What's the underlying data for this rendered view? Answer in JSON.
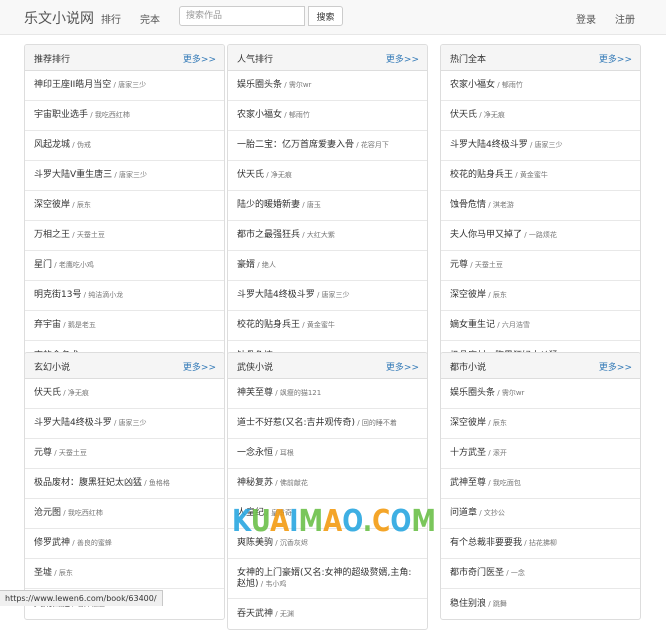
{
  "header": {
    "brand": "乐文小说网",
    "nav": [
      "排行",
      "完本"
    ],
    "search_placeholder": "搜索作品",
    "search_button": "搜索",
    "login": "登录",
    "register": "注册"
  },
  "panels": [
    {
      "title": "推荐排行",
      "more": "更多>>",
      "items": [
        {
          "title": "神印王座II皓月当空",
          "author": "唐家三少"
        },
        {
          "title": "宇宙职业选手",
          "author": "我吃西红柿"
        },
        {
          "title": "风起龙城",
          "author": "伪戒"
        },
        {
          "title": "斗罗大陆V重生唐三",
          "author": "唐家三少"
        },
        {
          "title": "深空彼岸",
          "author": "辰东"
        },
        {
          "title": "万相之王",
          "author": "天蚕土豆"
        },
        {
          "title": "星门",
          "author": "老鹰吃小鸡"
        },
        {
          "title": "明克街13号",
          "author": "纯洁滴小龙"
        },
        {
          "title": "弃宇宙",
          "author": "鹅是老五"
        },
        {
          "title": "夜的命名术",
          "author": "会说话的肘子"
        }
      ]
    },
    {
      "title": "人气排行",
      "more": "更多>>",
      "items": [
        {
          "title": "娱乐圈头条",
          "author": "需尔wr"
        },
        {
          "title": "农家小福女",
          "author": "郁雨竹"
        },
        {
          "title": "一胎二宝：亿万首席爱妻入骨",
          "author": "花容月下"
        },
        {
          "title": "伏天氏",
          "author": "净无痕"
        },
        {
          "title": "陆少的暖婚新妻",
          "author": "唐玉"
        },
        {
          "title": "都市之最强狂兵",
          "author": "大红大紫"
        },
        {
          "title": "豪婿",
          "author": "绝人"
        },
        {
          "title": "斗罗大陆4终极斗罗",
          "author": "唐家三少"
        },
        {
          "title": "校花的贴身兵王",
          "author": "黄金蜜牛"
        },
        {
          "title": "蚀骨危情",
          "author": "淇老游"
        }
      ]
    },
    {
      "title": "热门全本",
      "more": "更多>>",
      "items": [
        {
          "title": "农家小福女",
          "author": "郁雨竹"
        },
        {
          "title": "伏天氏",
          "author": "净无痕"
        },
        {
          "title": "斗罗大陆4终极斗罗",
          "author": "唐家三少"
        },
        {
          "title": "校花的贴身兵王",
          "author": "黄金蜜牛"
        },
        {
          "title": "蚀骨危情",
          "author": "淇老游"
        },
        {
          "title": "夫人你马甲又掉了",
          "author": "一路烦花"
        },
        {
          "title": "元尊",
          "author": "天蚕土豆"
        },
        {
          "title": "深空彼岸",
          "author": "辰东"
        },
        {
          "title": "嫡女重生记",
          "author": "六月浩雪"
        },
        {
          "title": "极品废材：腹黑狂妃太凶猛",
          "author": "鱼格格"
        }
      ]
    },
    {
      "title": "玄幻小说",
      "more": "更多>>",
      "items": [
        {
          "title": "伏天氏",
          "author": "净无痕"
        },
        {
          "title": "斗罗大陆4终极斗罗",
          "author": "唐家三少"
        },
        {
          "title": "元尊",
          "author": "天蚕土豆"
        },
        {
          "title": "极品废材：腹黑狂妃太凶猛",
          "author": "鱼格格"
        },
        {
          "title": "沧元图",
          "author": "我吃西红柿"
        },
        {
          "title": "修罗武神",
          "author": "善良的蜜蜂"
        },
        {
          "title": "圣墟",
          "author": "辰东"
        },
        {
          "title": "天荒仙庭",
          "author": "君开福胜"
        }
      ]
    },
    {
      "title": "武侠小说",
      "more": "更多>>",
      "items": [
        {
          "title": "神芙至尊",
          "author": "飒瘦的猫121"
        },
        {
          "title": "道士不好惹(又名:吉井观传奇)",
          "author": "回的睡不着"
        },
        {
          "title": "一念永恒",
          "author": "耳根"
        },
        {
          "title": "神秘复苏",
          "author": "佛前献花"
        },
        {
          "title": "人皇纪",
          "author": "皇甫奇"
        },
        {
          "title": "爽陈美驹",
          "author": "沉香灰烬"
        },
        {
          "title": "女神的上门豪婿(又名:女神的超级赘婿,主角:赵旭)",
          "author": "韦小鸡",
          "tall": true
        },
        {
          "title": "吞天武神",
          "author": "无渊"
        }
      ]
    },
    {
      "title": "都市小说",
      "more": "更多>>",
      "items": [
        {
          "title": "娱乐圈头条",
          "author": "需尔wr"
        },
        {
          "title": "深空彼岸",
          "author": "辰东"
        },
        {
          "title": "十方武圣",
          "author": "滚开"
        },
        {
          "title": "武神至尊",
          "author": "我吃面包"
        },
        {
          "title": "问道章",
          "author": "文抄公"
        },
        {
          "title": "有个总裁非要要我",
          "author": "拈花拂柳"
        },
        {
          "title": "都市奇门医圣",
          "author": "一念"
        },
        {
          "title": "稳住别浪",
          "author": "跳舞"
        }
      ]
    }
  ],
  "watermark": {
    "text": "KUAIMAO.COM",
    "colors": [
      "#2aa7e0",
      "#6cc04a",
      "#f39c12"
    ]
  },
  "status_url": "https://www.lewen6.com/book/63400/"
}
